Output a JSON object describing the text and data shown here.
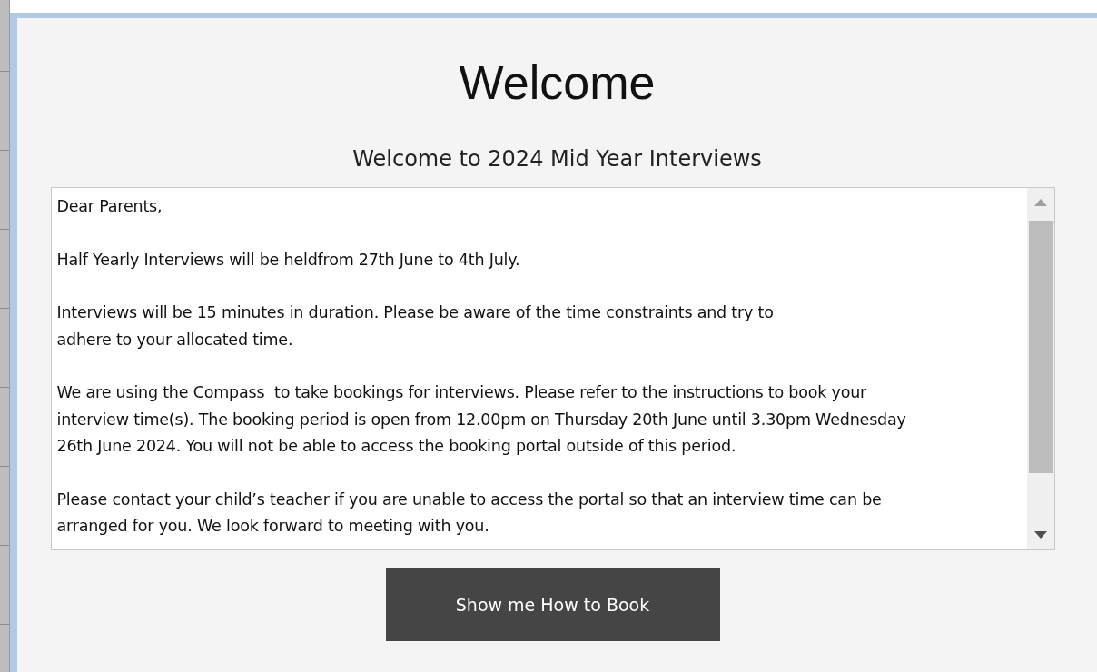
{
  "title": "Welcome",
  "subtitle": "Welcome to 2024 Mid Year Interviews",
  "message": {
    "paragraphs": [
      "Dear Parents,",
      "Half Yearly Interviews will be heldfrom 27th June to 4th July.",
      "Interviews will be 15 minutes in duration. Please be aware of the time constraints and try to\nadhere to your allocated time.",
      "We are using the Compass  to take bookings for interviews. Please refer to the instructions to book your\ninterview time(s). The booking period is open from 12.00pm on Thursday 20th June until 3.30pm Wednesday\n26th June 2024. You will not be able to access the booking portal outside of this period.",
      "Please contact your child’s teacher if you are unable to access the portal so that an interview time can be\narranged for you. We look forward to meeting with you."
    ]
  },
  "button": {
    "label": "Show me How to Book"
  }
}
